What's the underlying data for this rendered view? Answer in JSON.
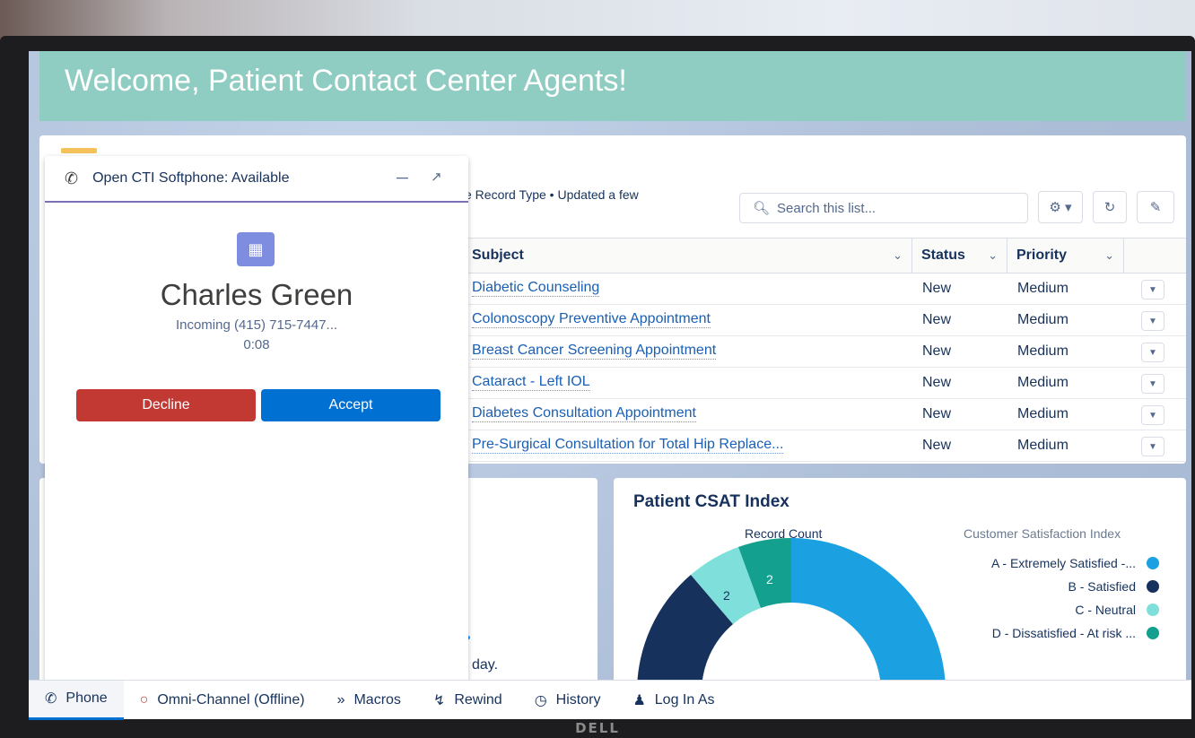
{
  "banner": {
    "title": "Welcome, Patient Contact Center Agents!"
  },
  "list": {
    "subtitle": "e Record Type • Updated a few",
    "search_placeholder": "Search this list...",
    "columns": {
      "subject": "Subject",
      "status": "Status",
      "priority": "Priority"
    },
    "rows": [
      {
        "subject": "Diabetic Counseling",
        "status": "New",
        "priority": "Medium"
      },
      {
        "subject": "Colonoscopy Preventive Appointment",
        "status": "New",
        "priority": "Medium"
      },
      {
        "subject": "Breast Cancer Screening Appointment",
        "status": "New",
        "priority": "Medium"
      },
      {
        "subject": "Cataract - Left IOL",
        "status": "New",
        "priority": "Medium"
      },
      {
        "subject": "Diabetes Consultation Appointment",
        "status": "New",
        "priority": "Medium"
      },
      {
        "subject": "Pre-Surgical Consultation for Total Hip Replace...",
        "status": "New",
        "priority": "Medium"
      }
    ]
  },
  "softphone": {
    "title": "Open CTI Softphone: Available",
    "caller_name": "Charles Green",
    "incoming": "Incoming (415) 715-7447...",
    "timer": "0:08",
    "decline_label": "Decline",
    "accept_label": "Accept"
  },
  "mid_card": {
    "text": "day."
  },
  "csat": {
    "title": "Patient CSAT Index",
    "record_count_label": "Record Count",
    "legend_title": "Customer Satisfaction Index",
    "legend": [
      {
        "label": "A - Extremely Satisfied -...",
        "color": "#1ba1e2"
      },
      {
        "label": "B - Satisfied",
        "color": "#16325c"
      },
      {
        "label": "C - Neutral",
        "color": "#7fe0db"
      },
      {
        "label": "D - Dissatisfied - At risk ...",
        "color": "#14a08e"
      }
    ],
    "slice_labels": [
      "2",
      "2"
    ]
  },
  "utility_bar": {
    "items": [
      {
        "label": "Phone",
        "icon": "phone-icon"
      },
      {
        "label": "Omni-Channel (Offline)",
        "icon": "circle-icon"
      },
      {
        "label": "Macros",
        "icon": "macros-icon"
      },
      {
        "label": "Rewind",
        "icon": "bolt-icon"
      },
      {
        "label": "History",
        "icon": "clock-icon"
      },
      {
        "label": "Log In As",
        "icon": "user-icon"
      }
    ]
  },
  "monitor": {
    "brand": "DELL"
  },
  "colors": {
    "banner": "#8fccc1",
    "decline": "#c23934",
    "accept": "#0070d2",
    "link": "#1a5fb4"
  }
}
